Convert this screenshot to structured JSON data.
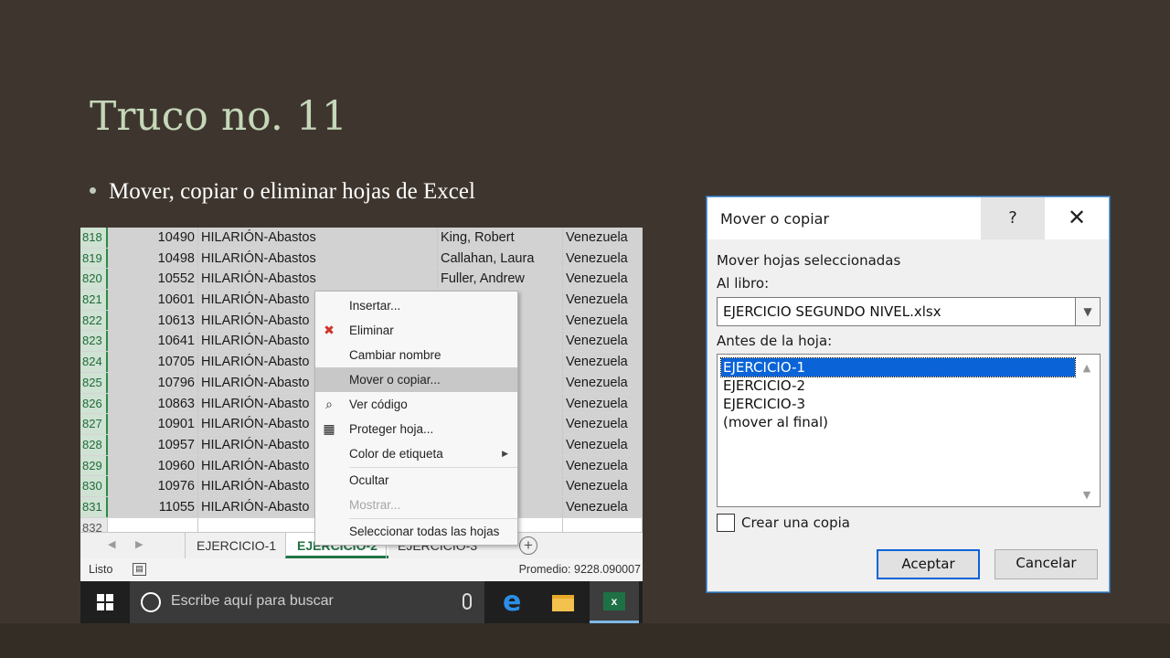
{
  "slide": {
    "title": "Truco no. 11",
    "bullet": "Mover, copiar o eliminar hojas de Excel"
  },
  "excel": {
    "rows": [
      {
        "row": "818",
        "id": "10490",
        "client": "HILARIÓN-Abastos",
        "employee": "King, Robert",
        "country": "Venezuela"
      },
      {
        "row": "819",
        "id": "10498",
        "client": "HILARIÓN-Abastos",
        "employee": "Callahan, Laura",
        "country": "Venezuela"
      },
      {
        "row": "820",
        "id": "10552",
        "client": "HILARIÓN-Abastos",
        "employee": "Fuller, Andrew",
        "country": "Venezuela"
      },
      {
        "row": "821",
        "id": "10601",
        "client": "HILARIÓN-Abasto",
        "employee": "",
        "country": "Venezuela"
      },
      {
        "row": "822",
        "id": "10613",
        "client": "HILARIÓN-Abasto",
        "employee": "rgaret",
        "country": "Venezuela"
      },
      {
        "row": "823",
        "id": "10641",
        "client": "HILARIÓN-Abasto",
        "employee": "rgaret",
        "country": "Venezuela"
      },
      {
        "row": "824",
        "id": "10705",
        "client": "HILARIÓN-Abasto",
        "employee": "Anne",
        "country": "Venezuela"
      },
      {
        "row": "825",
        "id": "10796",
        "client": "HILARIÓN-Abasto",
        "employee": "net",
        "country": "Venezuela"
      },
      {
        "row": "826",
        "id": "10863",
        "client": "HILARIÓN-Abasto",
        "employee": "rgaret",
        "country": "Venezuela"
      },
      {
        "row": "827",
        "id": "10901",
        "client": "HILARIÓN-Abasto",
        "employee": "rgaret",
        "country": "Venezuela"
      },
      {
        "row": "828",
        "id": "10957",
        "client": "HILARIÓN-Abasto",
        "employee": "ura",
        "country": "Venezuela"
      },
      {
        "row": "829",
        "id": "10960",
        "client": "HILARIÓN-Abasto",
        "employee": "net",
        "country": "Venezuela"
      },
      {
        "row": "830",
        "id": "10976",
        "client": "HILARIÓN-Abasto",
        "employee": "ncy",
        "country": "Venezuela"
      },
      {
        "row": "831",
        "id": "11055",
        "client": "HILARIÓN-Abasto",
        "employee": "",
        "country": "Venezuela"
      }
    ],
    "empty_row": "832",
    "tabs": {
      "tab1": "EJERCICIO-1",
      "tab2": "EJERCICIO-2",
      "tab3": "EJERCICIO-3",
      "add": "+"
    },
    "status": {
      "ready": "Listo",
      "average": "Promedio: 9228.090007"
    },
    "taskbar": {
      "search_placeholder": "Escribe aquí para buscar",
      "excel_glyph": "x"
    },
    "context_menu": {
      "insert": "Insertar...",
      "delete": "Eliminar",
      "rename": "Cambiar nombre",
      "move_copy": "Mover o copiar...",
      "view_code": "Ver código",
      "protect": "Proteger hoja...",
      "tab_color": "Color de etiqueta",
      "hide": "Ocultar",
      "unhide": "Mostrar...",
      "select_all": "Seleccionar todas las hojas"
    }
  },
  "dialog": {
    "title": "Mover o copiar",
    "help": "?",
    "close": "✕",
    "section_label": "Mover hojas seleccionadas",
    "book_label": "Al libro:",
    "book_value": "EJERCICIO SEGUNDO NIVEL.xlsx",
    "before_label": "Antes de la hoja:",
    "sheets": [
      "EJERCICIO-1",
      "EJERCICIO-2",
      "EJERCICIO-3",
      "(mover al final)"
    ],
    "create_copy": "Crear una copia",
    "ok": "Aceptar",
    "cancel": "Cancelar"
  }
}
